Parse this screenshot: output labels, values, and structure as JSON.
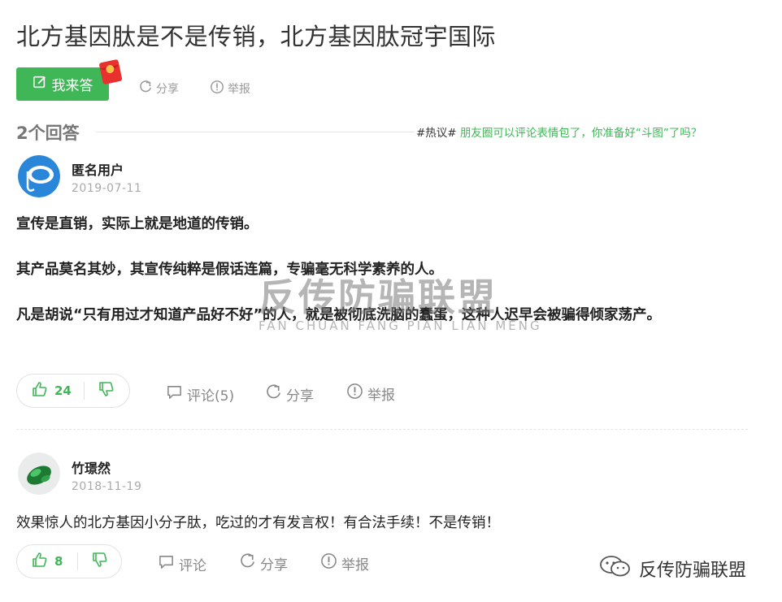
{
  "question": {
    "title": "北方基因肽是不是传销，北方基因肽冠宇国际"
  },
  "actions": {
    "answer_label": "我来答",
    "share_label": "分享",
    "report_label": "举报"
  },
  "answers_header": {
    "count_label": "2个回答",
    "hot_tag": "#热议#",
    "hot_topic": "朋友圈可以评论表情包了，你准备好“斗图”了吗？"
  },
  "answers": [
    {
      "user": "匿名用户",
      "date": "2019-07-11",
      "paragraphs": [
        "宣传是直销，实际上就是地道的传销。",
        "其产品莫名其妙，其宣传纯粹是假话连篇，专骗毫无科学素养的人。",
        "凡是胡说“只有用过才知道产品好不好”的人，就是被彻底洗脑的蠢蛋，这种人迟早会被骗得倾家荡产。"
      ],
      "likes": "24",
      "comment_label": "评论(5)",
      "share_label": "分享",
      "report_label": "举报"
    },
    {
      "user": "竹璟然",
      "date": "2018-11-19",
      "paragraphs": [
        "效果惊人的北方基因小分子肽，吃过的才有发言权！有合法手续！不是传销！"
      ],
      "likes": "8",
      "comment_label": "评论",
      "share_label": "分享",
      "report_label": "举报"
    }
  ],
  "watermark": {
    "text": "反传防骗联盟",
    "pinyin": "FAN CHUAN FANG PIAN LIAN MENG"
  },
  "brand": {
    "name": "反传防骗联盟"
  },
  "colors": {
    "accent": "#3fb757",
    "muted": "#999999"
  },
  "icons": [
    "edit-icon",
    "red-packet-icon",
    "share-icon",
    "report-icon",
    "thumb-up-icon",
    "thumb-down-icon",
    "comment-icon",
    "wechat-icon"
  ]
}
